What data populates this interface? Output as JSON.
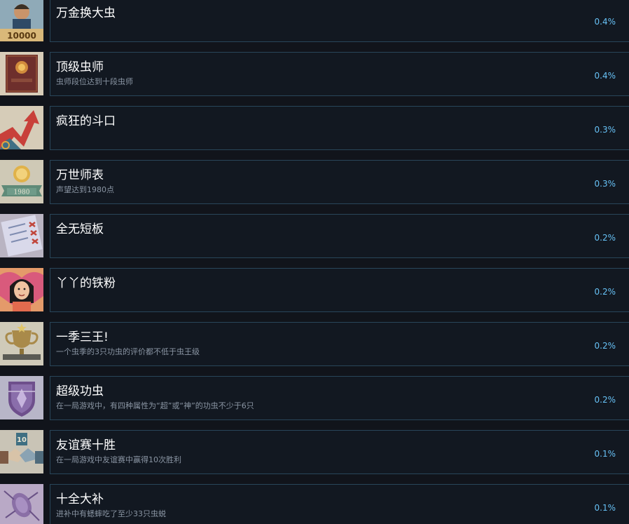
{
  "achievements": [
    {
      "title": "万金换大虫",
      "description": "",
      "percent": "0.4%",
      "icon": "money-man-icon"
    },
    {
      "title": "顶级虫师",
      "description": "虫师段位达到十段虫师",
      "percent": "0.4%",
      "icon": "book-icon"
    },
    {
      "title": "疯狂的斗口",
      "description": "",
      "percent": "0.3%",
      "icon": "rising-arrow-icon"
    },
    {
      "title": "万世师表",
      "description": "声望达到1980点",
      "percent": "0.3%",
      "icon": "medal-ribbon-icon"
    },
    {
      "title": "全无短板",
      "description": "",
      "percent": "0.2%",
      "icon": "checklist-icon"
    },
    {
      "title": "丫丫的铁粉",
      "description": "",
      "percent": "0.2%",
      "icon": "girl-portrait-icon"
    },
    {
      "title": "一季三王!",
      "description": "一个虫季的3只功虫的评价都不低于虫王级",
      "percent": "0.2%",
      "icon": "trophy-icon"
    },
    {
      "title": "超级功虫",
      "description": "在一局游戏中，有四种属性为“超”或“神”的功虫不少于6只",
      "percent": "0.2%",
      "icon": "shield-crest-icon"
    },
    {
      "title": "友谊赛十胜",
      "description": "在一局游戏中友谊赛中赢得10次胜利",
      "percent": "0.1%",
      "icon": "handshake-icon"
    },
    {
      "title": "十全大补",
      "description": "进补中有蟋蟀吃了至少33只虫蜕",
      "percent": "0.1%",
      "icon": "cricket-shell-icon"
    }
  ],
  "icon_labels": {
    "money": "10000",
    "medal_year": "1980",
    "handshake_number": "10"
  }
}
